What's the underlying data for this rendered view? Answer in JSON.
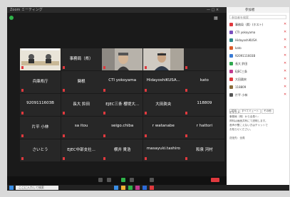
{
  "window": {
    "title": "Zoom ミーティング",
    "controls": "—  □  ×"
  },
  "participants": [
    {
      "name": "",
      "video": "room"
    },
    {
      "name": "事務局（県）",
      "video": ""
    },
    {
      "name": "",
      "video": "man1"
    },
    {
      "name": "",
      "video": "man2"
    },
    {
      "name": "",
      "video": ""
    },
    {
      "name": "兵庫県庁",
      "video": ""
    },
    {
      "name": "関根",
      "video": ""
    },
    {
      "name": "CTI yokoyama",
      "video": ""
    },
    {
      "name": "HidayoshiKUSA...",
      "video": ""
    },
    {
      "name": "kato",
      "video": ""
    },
    {
      "name": "9209111603B",
      "video": ""
    },
    {
      "name": "長大 鈴田",
      "video": ""
    },
    {
      "name": "EJEC三条 櫻堤大...",
      "video": ""
    },
    {
      "name": "大田眞央",
      "video": ""
    },
    {
      "name": "118809",
      "video": ""
    },
    {
      "name": "片平 小林",
      "video": ""
    },
    {
      "name": "sa itou",
      "video": ""
    },
    {
      "name": "seigo.chiba",
      "video": ""
    },
    {
      "name": "r watanabe",
      "video": ""
    },
    {
      "name": "r hattori",
      "video": ""
    },
    {
      "name": "さいとう",
      "video": ""
    },
    {
      "name": "EJEC中部支社...",
      "video": ""
    },
    {
      "name": "横井 貴浩",
      "video": ""
    },
    {
      "name": "masayuki.tashiro",
      "video": ""
    },
    {
      "name": "和泉 河村",
      "video": ""
    }
  ],
  "side": {
    "header": "参加者",
    "search": "参加者を検索",
    "people": [
      {
        "name": "事務局（県）(ホスト)",
        "color": "#e0393e"
      },
      {
        "name": "CTI yokoyama",
        "color": "#7a4fbf"
      },
      {
        "name": "HidayoshiKUSA",
        "color": "#2d8a8a"
      },
      {
        "name": "kato",
        "color": "#d95b2a"
      },
      {
        "name": "9209111603B",
        "color": "#3a7bd5"
      },
      {
        "name": "長大 鈴田",
        "color": "#2fa84f"
      },
      {
        "name": "EJEC三条",
        "color": "#c23b8f"
      },
      {
        "name": "大田眞央",
        "color": "#e0393e"
      },
      {
        "name": "118809",
        "color": "#8a6d3b"
      },
      {
        "name": "片平 小林",
        "color": "#555555"
      }
    ],
    "buttons": [
      "招待",
      "すべてミュート",
      "その他"
    ],
    "chat_lines": [
      "チャット",
      "事務局（県）から全員へ：",
      "資料は画面共有にて説明します。",
      "音声が聞こえない方はチャットで",
      "お知らせください。",
      "",
      "送信先：全員"
    ]
  },
  "taskbar": {
    "search": "ここに入力して検索"
  }
}
